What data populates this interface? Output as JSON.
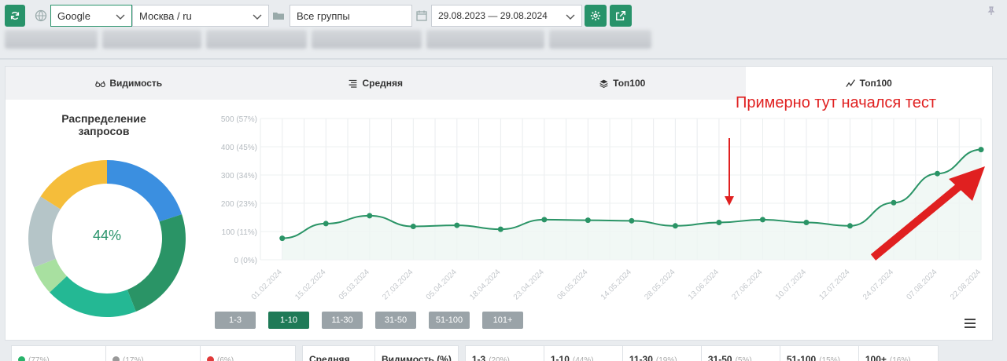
{
  "toolbar": {
    "engine": "Google",
    "region": "Москва / ru",
    "group": "Все группы",
    "date_range": "29.08.2023 — 29.08.2024"
  },
  "tabs": [
    {
      "label": "Видимость",
      "icon": "glasses-icon"
    },
    {
      "label": "Средняя",
      "icon": "align-icon"
    },
    {
      "label": "Топ100",
      "icon": "layers-icon"
    },
    {
      "label": "Топ100",
      "icon": "trend-icon",
      "active": true
    }
  ],
  "donut": {
    "title_line1": "Распределение",
    "title_line2": "запросов",
    "center_label": "44%",
    "segments": [
      {
        "value": 20,
        "color": "#3b8fe0"
      },
      {
        "value": 24,
        "color": "#2a9466"
      },
      {
        "value": 19,
        "color": "#24b894"
      },
      {
        "value": 6,
        "color": "#a8e0a0"
      },
      {
        "value": 15,
        "color": "#b5c5c8"
      },
      {
        "value": 16,
        "color": "#f5bd3a"
      }
    ]
  },
  "chart_data": {
    "type": "area",
    "y_ticks": [
      "0 (0%)",
      "100 (11%)",
      "200 (23%)",
      "300 (34%)",
      "400 (45%)",
      "500 (57%)"
    ],
    "ylim": [
      0,
      500
    ],
    "categories": [
      "01.02.2024",
      "15.02.2024",
      "05.03.2024",
      "27.03.2024",
      "05.04.2024",
      "18.04.2024",
      "23.04.2024",
      "06.05.2024",
      "14.05.2024",
      "28.05.2024",
      "13.06.2024",
      "27.06.2024",
      "10.07.2024",
      "12.07.2024",
      "24.07.2024",
      "07.08.2024",
      "22.08.2024"
    ],
    "x": [
      0,
      1,
      2,
      3,
      4,
      5,
      6,
      7,
      8,
      9,
      10,
      11,
      12,
      13,
      14,
      15,
      16,
      17,
      18,
      19,
      20,
      21,
      22,
      23,
      24,
      25,
      26,
      27,
      28,
      29,
      30,
      31,
      32,
      33
    ],
    "point_indices": [
      1,
      3,
      5,
      7,
      9,
      11,
      13,
      15,
      17,
      19,
      21,
      23,
      25,
      27,
      29,
      31,
      33
    ],
    "values": [
      76,
      128,
      156,
      118,
      122,
      108,
      142,
      140,
      138,
      120,
      132,
      142,
      132,
      120,
      202,
      305,
      390
    ],
    "color": "#2a9466"
  },
  "annotation": "Примерно тут начался тест",
  "range_buttons": [
    "1-3",
    "1-10",
    "11-30",
    "31-50",
    "51-100",
    "101+"
  ],
  "range_active": 1,
  "bottom": {
    "g1": [
      {
        "label": "",
        "pct": "(77%)",
        "color": "#28b36a"
      },
      {
        "label": "",
        "pct": "(17%)",
        "color": "#999"
      },
      {
        "label": "",
        "pct": "(6%)",
        "color": "#e03a3a"
      }
    ],
    "g2": [
      {
        "label": "Средняя",
        "pct": ""
      },
      {
        "label": "Видимость (%)",
        "pct": ""
      }
    ],
    "g3": [
      {
        "label": "1-3",
        "pct": "(20%)"
      },
      {
        "label": "1-10",
        "pct": "(44%)"
      },
      {
        "label": "11-30",
        "pct": "(19%)"
      },
      {
        "label": "31-50",
        "pct": "(5%)"
      },
      {
        "label": "51-100",
        "pct": "(15%)"
      },
      {
        "label": "100+",
        "pct": "(16%)"
      }
    ]
  }
}
